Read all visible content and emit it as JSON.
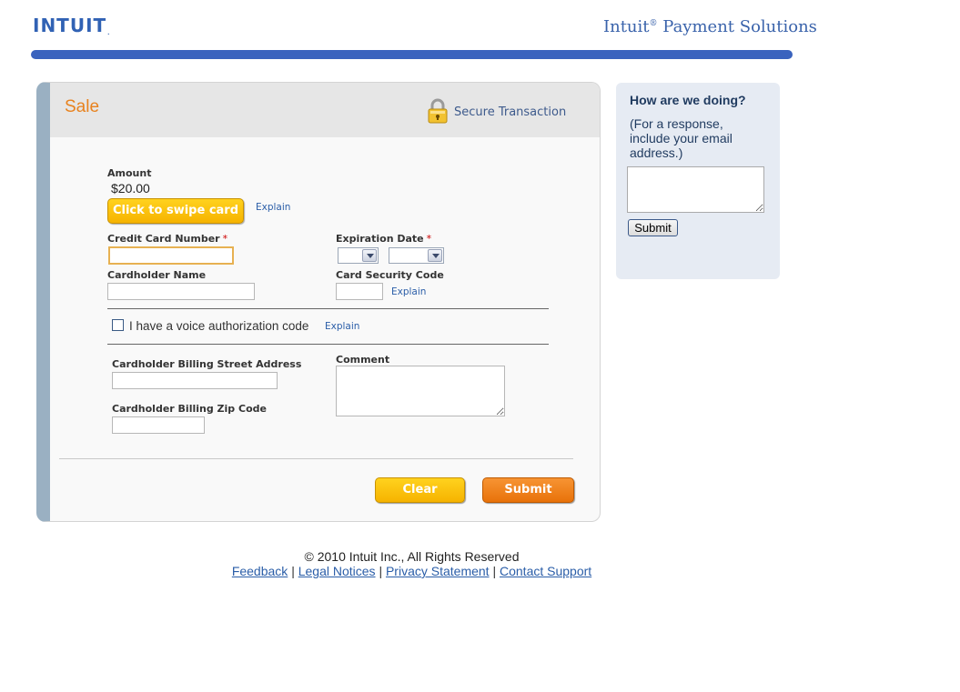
{
  "header": {
    "logo": "INTUIT",
    "brand": "Intuit",
    "brand_mark": "®",
    "brand_suffix": "Payment Solutions"
  },
  "panel": {
    "title": "Sale",
    "secure_label": "Secure Transaction",
    "amount_label": "Amount",
    "amount_value": "$20.00",
    "swipe_button": "Click to swipe card",
    "swipe_explain": "Explain",
    "card_number_label": "Credit Card Number",
    "expiration_label": "Expiration Date",
    "required_mark": "*",
    "cardholder_name_label": "Cardholder Name",
    "security_code_label": "Card Security Code",
    "security_explain": "Explain",
    "voice_auth_label": "I have a voice authorization code",
    "voice_explain": "Explain",
    "billing_street_label": "Cardholder Billing Street Address",
    "billing_zip_label": "Cardholder Billing Zip Code",
    "comment_label": "Comment",
    "clear_button": "Clear",
    "submit_button": "Submit"
  },
  "feedback": {
    "title": "How are we doing?",
    "text": "(For a response, include your email address.)",
    "submit_button": "Submit"
  },
  "footer": {
    "copyright": "© 2010 Intuit Inc., All Rights Reserved",
    "links": [
      "Feedback",
      "Legal Notices",
      "Privacy Statement",
      "Contact Support"
    ],
    "separator": "|"
  },
  "colors": {
    "accent_blue": "#3a63be",
    "sale_orange": "#e8821e",
    "swipe_yellow": "#f6b300",
    "submit_orange": "#e8720a",
    "panel_side": "#9ab0c2",
    "required_red": "#cc0000"
  },
  "icons": [
    "lock-icon",
    "chevron-down-icon"
  ]
}
